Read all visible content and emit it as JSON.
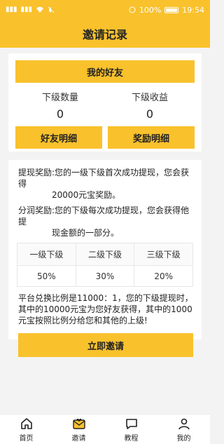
{
  "status_bar": {
    "left_icons": [
      "signal-icon",
      "signal-icon",
      "wifi-icon",
      "mute-icon"
    ],
    "battery_percent": "100%",
    "time": "19:54"
  },
  "header": {
    "title": "邀请记录"
  },
  "friends_card": {
    "my_friends_label": "我的好友",
    "sub_count_label": "下级数量",
    "sub_count_value": "0",
    "sub_income_label": "下级收益",
    "sub_income_value": "0",
    "friend_detail_label": "好友明细",
    "reward_detail_label": "奖励明细"
  },
  "rules_card": {
    "withdraw_reward_title": "提现奖励:",
    "withdraw_reward_text_1": "您的一级下级首次成功提现，您会获得",
    "withdraw_reward_text_2": "20000元宝奖励。",
    "share_reward_title": "分润奖励:",
    "share_reward_text_1": "您的下级每次成功提现，您会获得他提",
    "share_reward_text_2": "现金额的一部分。",
    "table_headers": [
      "一级下级",
      "二级下级",
      "三级下级"
    ],
    "table_values": [
      "50%",
      "30%",
      "20%"
    ],
    "note": "平台兑换比例是11000：1，您的下级提现时，其中的10000元宝为您好友获得，其中的1000元宝按照比例分给您和其他的上级!",
    "invite_button": "立即邀请"
  },
  "tabbar": {
    "items": [
      {
        "label": "首页",
        "icon": "home-icon"
      },
      {
        "label": "邀请",
        "icon": "invite-icon"
      },
      {
        "label": "教程",
        "icon": "chat-icon"
      },
      {
        "label": "我的",
        "icon": "user-icon"
      }
    ]
  }
}
